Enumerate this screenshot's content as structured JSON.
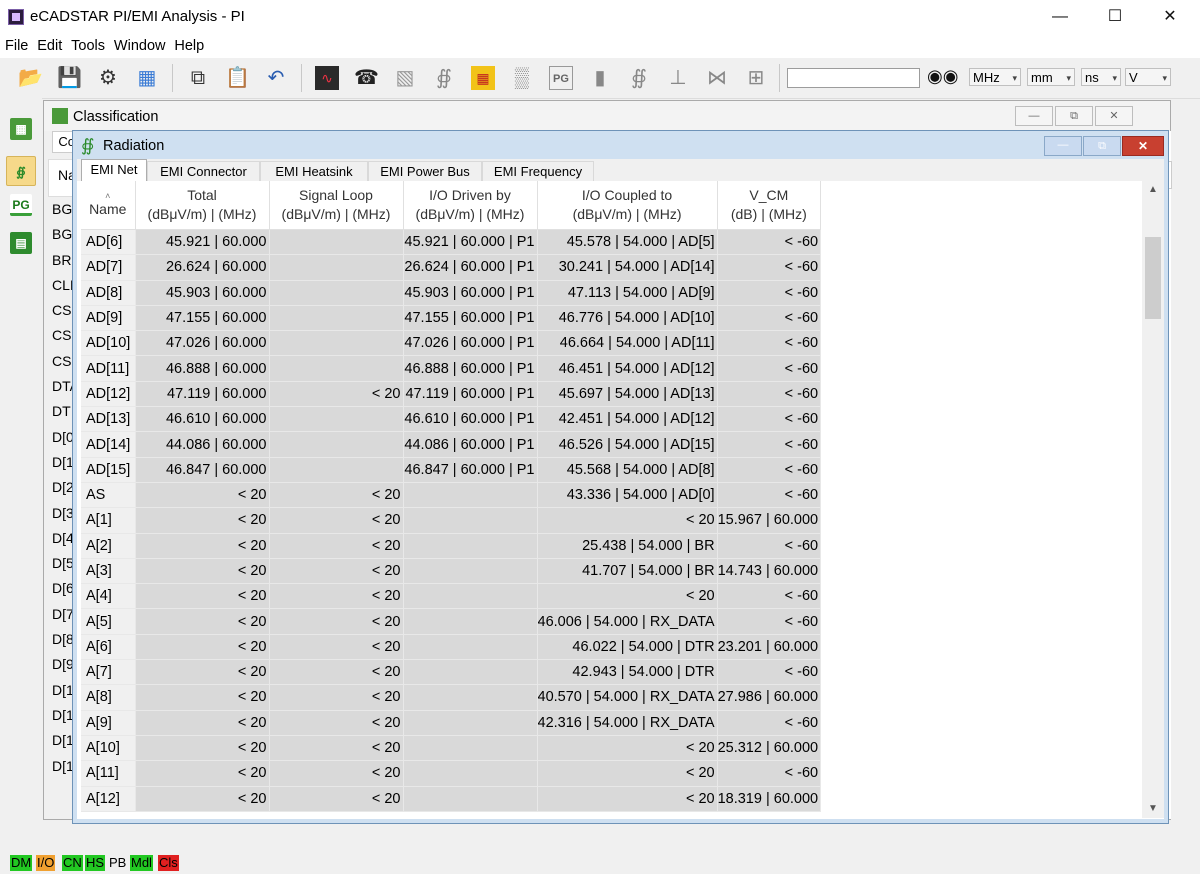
{
  "app": {
    "title": "eCADSTAR PI/EMI Analysis - PI"
  },
  "menu": [
    "File",
    "Edit",
    "Tools",
    "Window",
    "Help"
  ],
  "toolbar": {
    "search": {
      "value": "",
      "placeholder": ""
    },
    "units": [
      "MHz",
      "mm",
      "ns",
      "V"
    ]
  },
  "dock": [
    "DM",
    "I/O",
    "PG",
    "Cls"
  ],
  "classification": {
    "title": "Classification",
    "tab_fragment": "Co",
    "name_label": "Na",
    "visible_names": [
      "BG",
      "BG",
      "BR",
      "CLI",
      "CS(",
      "CS",
      "CS.",
      "DTA",
      "DT",
      "D[0",
      "D[1",
      "D[2",
      "D[3",
      "D[4",
      "D[5",
      "D[6",
      "D[7",
      "D[8",
      "D[9",
      "D[1",
      "D[1",
      "D[1",
      "D[1"
    ]
  },
  "radiation": {
    "title": "Radiation",
    "tabs": [
      "EMI Net",
      "EMI Connector",
      "EMI Heatsink",
      "EMI Power Bus",
      "EMI Frequency"
    ],
    "columns": [
      {
        "line1": "Name",
        "line2": ""
      },
      {
        "line1": "Total",
        "line2": "(dBμV/m) | (MHz)"
      },
      {
        "line1": "Signal Loop",
        "line2": "(dBμV/m) | (MHz)"
      },
      {
        "line1": "I/O Driven by",
        "line2": "(dBμV/m) | (MHz)"
      },
      {
        "line1": "I/O Coupled to",
        "line2": "(dBμV/m) | (MHz)"
      },
      {
        "line1": "V_CM",
        "line2": "(dB) | (MHz)"
      }
    ],
    "rows": [
      [
        "AD[6]",
        "45.921 | 60.000",
        "",
        "45.921 | 60.000 | P1",
        "45.578 | 54.000 | AD[5]",
        "< -60"
      ],
      [
        "AD[7]",
        "26.624 | 60.000",
        "",
        "26.624 | 60.000 | P1",
        "30.241 | 54.000 | AD[14]",
        "< -60"
      ],
      [
        "AD[8]",
        "45.903 | 60.000",
        "",
        "45.903 | 60.000 | P1",
        "47.113 | 54.000 | AD[9]",
        "< -60"
      ],
      [
        "AD[9]",
        "47.155 | 60.000",
        "",
        "47.155 | 60.000 | P1",
        "46.776 | 54.000 | AD[10]",
        "< -60"
      ],
      [
        "AD[10]",
        "47.026 | 60.000",
        "",
        "47.026 | 60.000 | P1",
        "46.664 | 54.000 | AD[11]",
        "< -60"
      ],
      [
        "AD[11]",
        "46.888 | 60.000",
        "",
        "46.888 | 60.000 | P1",
        "46.451 | 54.000 | AD[12]",
        "< -60"
      ],
      [
        "AD[12]",
        "47.119 | 60.000",
        "< 20",
        "47.119 | 60.000 | P1",
        "45.697 | 54.000 | AD[13]",
        "< -60"
      ],
      [
        "AD[13]",
        "46.610 | 60.000",
        "",
        "46.610 | 60.000 | P1",
        "42.451 | 54.000 | AD[12]",
        "< -60"
      ],
      [
        "AD[14]",
        "44.086 | 60.000",
        "",
        "44.086 | 60.000 | P1",
        "46.526 | 54.000 | AD[15]",
        "< -60"
      ],
      [
        "AD[15]",
        "46.847 | 60.000",
        "",
        "46.847 | 60.000 | P1",
        "45.568 | 54.000 | AD[8]",
        "< -60"
      ],
      [
        "AS",
        "< 20",
        "< 20",
        "",
        "43.336 | 54.000 | AD[0]",
        "< -60"
      ],
      [
        "A[1]",
        "< 20",
        "< 20",
        "",
        "< 20",
        "15.967 | 60.000"
      ],
      [
        "A[2]",
        "< 20",
        "< 20",
        "",
        "25.438 | 54.000 | BR",
        "< -60"
      ],
      [
        "A[3]",
        "< 20",
        "< 20",
        "",
        "41.707 | 54.000 | BR",
        "14.743 | 60.000"
      ],
      [
        "A[4]",
        "< 20",
        "< 20",
        "",
        "< 20",
        "< -60"
      ],
      [
        "A[5]",
        "< 20",
        "< 20",
        "",
        "46.006 | 54.000 | RX_DATA",
        "< -60"
      ],
      [
        "A[6]",
        "< 20",
        "< 20",
        "",
        "46.022 | 54.000 | DTR",
        "23.201 | 60.000"
      ],
      [
        "A[7]",
        "< 20",
        "< 20",
        "",
        "42.943 | 54.000 | DTR",
        "< -60"
      ],
      [
        "A[8]",
        "< 20",
        "< 20",
        "",
        "40.570 | 54.000 | RX_DATA",
        "27.986 | 60.000"
      ],
      [
        "A[9]",
        "< 20",
        "< 20",
        "",
        "42.316 | 54.000 | RX_DATA",
        "< -60"
      ],
      [
        "A[10]",
        "< 20",
        "< 20",
        "",
        "< 20",
        "25.312 | 60.000"
      ],
      [
        "A[11]",
        "< 20",
        "< 20",
        "",
        "< 20",
        "< -60"
      ],
      [
        "A[12]",
        "< 20",
        "< 20",
        "",
        "< 20",
        "18.319 | 60.000"
      ]
    ]
  },
  "statusbar": [
    {
      "label": "DM",
      "color": "#22c822"
    },
    {
      "label": "I/O",
      "color": "#f0a030"
    },
    {
      "label": "CN",
      "color": "#22c822"
    },
    {
      "label": "HS",
      "color": "#22c822"
    },
    {
      "label": "PB",
      "color": ""
    },
    {
      "label": "Mdl",
      "color": "#22c822"
    },
    {
      "label": "Cls",
      "color": "#e02020"
    }
  ]
}
